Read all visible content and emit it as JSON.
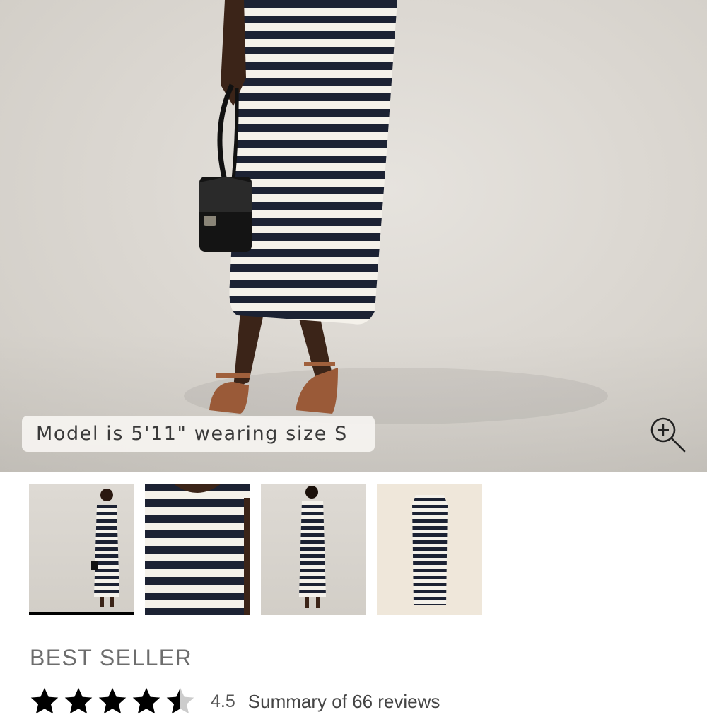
{
  "hero": {
    "caption": "Model is 5'11\" wearing size S",
    "zoom_icon": "zoom-in-icon"
  },
  "thumbnails": [
    {
      "label": "full-length front view",
      "active": true
    },
    {
      "label": "neckline close-up",
      "active": false
    },
    {
      "label": "back view",
      "active": false
    },
    {
      "label": "flat product view",
      "active": false
    }
  ],
  "product": {
    "badge": "BEST SELLER",
    "rating": {
      "value": "4.5",
      "stars_filled": 4.5,
      "stars_total": 5,
      "summary": "Summary of 66 reviews"
    }
  },
  "colors": {
    "stripe_navy": "#1c2233",
    "stripe_cream": "#f4f1ea",
    "star": "#000000",
    "badge_text": "#6d6d6d"
  }
}
